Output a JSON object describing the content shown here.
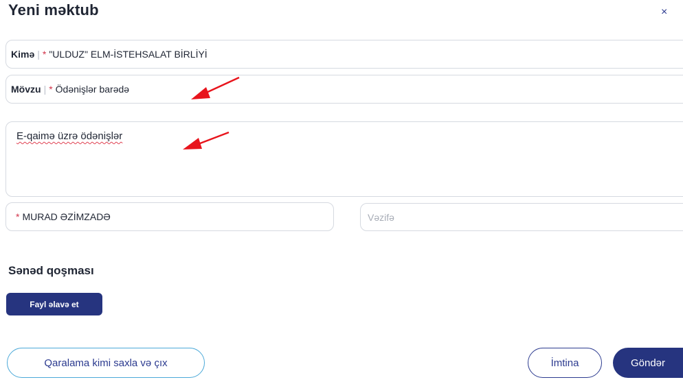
{
  "dialog": {
    "title": "Yeni məktub",
    "close_glyph": "×"
  },
  "form": {
    "to": {
      "label": "Kimə",
      "separator": "|",
      "required_mark": "*",
      "value": "\"ULDUZ\" ELM-İSTEHSALAT BİRLİYİ"
    },
    "subject": {
      "label": "Mövzu",
      "separator": "|",
      "required_mark": "*",
      "value": "Ödənişlər barədə"
    },
    "body": {
      "value": "E-qaimə üzrə ödənişlər"
    },
    "signer": {
      "required_mark": "*",
      "value": "MURAD ƏZİMZADƏ"
    },
    "position": {
      "placeholder": "Vəzifə",
      "value": ""
    }
  },
  "attachments": {
    "title": "Sənəd qoşması",
    "add_label": "Fayl əlavə et"
  },
  "footer": {
    "draft_label": "Qaralama kimi saxla və çıx",
    "cancel_label": "İmtina",
    "send_label": "Göndər"
  },
  "colors": {
    "primary": "#26347f",
    "draft_border": "#4aa8d8",
    "required": "#d2344a",
    "annotation_arrow": "#e8141c"
  }
}
